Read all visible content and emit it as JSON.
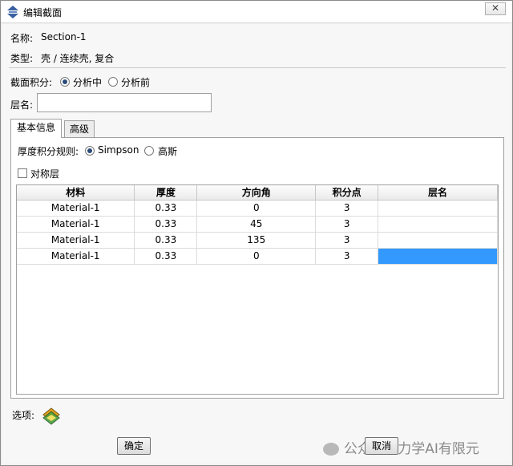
{
  "window": {
    "title": "编辑截面",
    "close_label": "✕"
  },
  "section": {
    "name_label": "名称:",
    "name_value": "Section-1",
    "type_label": "类型:",
    "type_value": "壳 / 连续壳, 复合"
  },
  "integration": {
    "label": "截面积分:",
    "options": [
      {
        "label": "分析中",
        "checked": true
      },
      {
        "label": "分析前",
        "checked": false
      }
    ]
  },
  "layer_name": {
    "label": "层名:",
    "value": ""
  },
  "tabs": [
    {
      "label": "基本信息",
      "active": true
    },
    {
      "label": "高级",
      "active": false
    }
  ],
  "thickness_rule": {
    "label": "厚度积分规则:",
    "options": [
      {
        "label": "Simpson",
        "checked": true
      },
      {
        "label": "高斯",
        "checked": false
      }
    ]
  },
  "symmetric": {
    "label": "对称层",
    "checked": false
  },
  "table": {
    "columns": [
      "材料",
      "厚度",
      "方向角",
      "积分点",
      "层名"
    ],
    "rows": [
      [
        "Material-1",
        "0.33",
        "0",
        "3",
        ""
      ],
      [
        "Material-1",
        "0.33",
        "45",
        "3",
        ""
      ],
      [
        "Material-1",
        "0.33",
        "135",
        "3",
        ""
      ],
      [
        "Material-1",
        "0.33",
        "0",
        "3",
        ""
      ]
    ]
  },
  "options_label": "选项:",
  "buttons": {
    "ok": "确定",
    "cancel": "取消"
  },
  "watermark": "公众号 · 力学AI有限元",
  "icons": [
    "app-icon",
    "close-icon",
    "radio-icon",
    "checkbox-icon",
    "layer-options-icon"
  ]
}
